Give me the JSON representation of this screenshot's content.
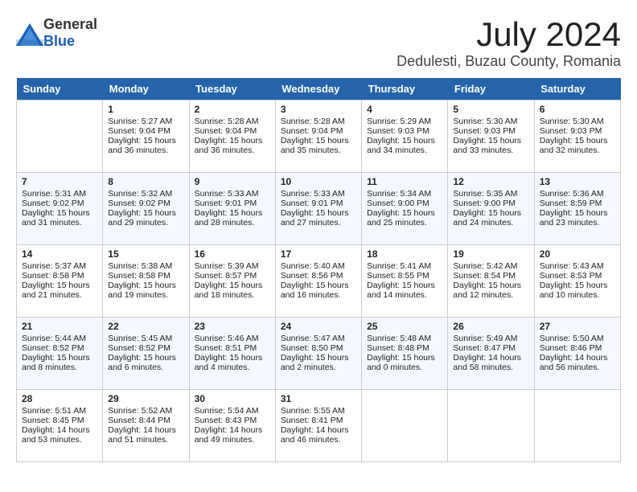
{
  "header": {
    "logo_general": "General",
    "logo_blue": "Blue",
    "month": "July 2024",
    "location": "Dedulesti, Buzau County, Romania"
  },
  "weekdays": [
    "Sunday",
    "Monday",
    "Tuesday",
    "Wednesday",
    "Thursday",
    "Friday",
    "Saturday"
  ],
  "weeks": [
    [
      {
        "day": "",
        "empty": true
      },
      {
        "day": "1",
        "sunrise": "Sunrise: 5:27 AM",
        "sunset": "Sunset: 9:04 PM",
        "daylight": "Daylight: 15 hours and 36 minutes."
      },
      {
        "day": "2",
        "sunrise": "Sunrise: 5:28 AM",
        "sunset": "Sunset: 9:04 PM",
        "daylight": "Daylight: 15 hours and 36 minutes."
      },
      {
        "day": "3",
        "sunrise": "Sunrise: 5:28 AM",
        "sunset": "Sunset: 9:04 PM",
        "daylight": "Daylight: 15 hours and 35 minutes."
      },
      {
        "day": "4",
        "sunrise": "Sunrise: 5:29 AM",
        "sunset": "Sunset: 9:03 PM",
        "daylight": "Daylight: 15 hours and 34 minutes."
      },
      {
        "day": "5",
        "sunrise": "Sunrise: 5:30 AM",
        "sunset": "Sunset: 9:03 PM",
        "daylight": "Daylight: 15 hours and 33 minutes."
      },
      {
        "day": "6",
        "sunrise": "Sunrise: 5:30 AM",
        "sunset": "Sunset: 9:03 PM",
        "daylight": "Daylight: 15 hours and 32 minutes."
      }
    ],
    [
      {
        "day": "7",
        "sunrise": "Sunrise: 5:31 AM",
        "sunset": "Sunset: 9:02 PM",
        "daylight": "Daylight: 15 hours and 31 minutes."
      },
      {
        "day": "8",
        "sunrise": "Sunrise: 5:32 AM",
        "sunset": "Sunset: 9:02 PM",
        "daylight": "Daylight: 15 hours and 29 minutes."
      },
      {
        "day": "9",
        "sunrise": "Sunrise: 5:33 AM",
        "sunset": "Sunset: 9:01 PM",
        "daylight": "Daylight: 15 hours and 28 minutes."
      },
      {
        "day": "10",
        "sunrise": "Sunrise: 5:33 AM",
        "sunset": "Sunset: 9:01 PM",
        "daylight": "Daylight: 15 hours and 27 minutes."
      },
      {
        "day": "11",
        "sunrise": "Sunrise: 5:34 AM",
        "sunset": "Sunset: 9:00 PM",
        "daylight": "Daylight: 15 hours and 25 minutes."
      },
      {
        "day": "12",
        "sunrise": "Sunrise: 5:35 AM",
        "sunset": "Sunset: 9:00 PM",
        "daylight": "Daylight: 15 hours and 24 minutes."
      },
      {
        "day": "13",
        "sunrise": "Sunrise: 5:36 AM",
        "sunset": "Sunset: 8:59 PM",
        "daylight": "Daylight: 15 hours and 23 minutes."
      }
    ],
    [
      {
        "day": "14",
        "sunrise": "Sunrise: 5:37 AM",
        "sunset": "Sunset: 8:58 PM",
        "daylight": "Daylight: 15 hours and 21 minutes."
      },
      {
        "day": "15",
        "sunrise": "Sunrise: 5:38 AM",
        "sunset": "Sunset: 8:58 PM",
        "daylight": "Daylight: 15 hours and 19 minutes."
      },
      {
        "day": "16",
        "sunrise": "Sunrise: 5:39 AM",
        "sunset": "Sunset: 8:57 PM",
        "daylight": "Daylight: 15 hours and 18 minutes."
      },
      {
        "day": "17",
        "sunrise": "Sunrise: 5:40 AM",
        "sunset": "Sunset: 8:56 PM",
        "daylight": "Daylight: 15 hours and 16 minutes."
      },
      {
        "day": "18",
        "sunrise": "Sunrise: 5:41 AM",
        "sunset": "Sunset: 8:55 PM",
        "daylight": "Daylight: 15 hours and 14 minutes."
      },
      {
        "day": "19",
        "sunrise": "Sunrise: 5:42 AM",
        "sunset": "Sunset: 8:54 PM",
        "daylight": "Daylight: 15 hours and 12 minutes."
      },
      {
        "day": "20",
        "sunrise": "Sunrise: 5:43 AM",
        "sunset": "Sunset: 8:53 PM",
        "daylight": "Daylight: 15 hours and 10 minutes."
      }
    ],
    [
      {
        "day": "21",
        "sunrise": "Sunrise: 5:44 AM",
        "sunset": "Sunset: 8:52 PM",
        "daylight": "Daylight: 15 hours and 8 minutes."
      },
      {
        "day": "22",
        "sunrise": "Sunrise: 5:45 AM",
        "sunset": "Sunset: 8:52 PM",
        "daylight": "Daylight: 15 hours and 6 minutes."
      },
      {
        "day": "23",
        "sunrise": "Sunrise: 5:46 AM",
        "sunset": "Sunset: 8:51 PM",
        "daylight": "Daylight: 15 hours and 4 minutes."
      },
      {
        "day": "24",
        "sunrise": "Sunrise: 5:47 AM",
        "sunset": "Sunset: 8:50 PM",
        "daylight": "Daylight: 15 hours and 2 minutes."
      },
      {
        "day": "25",
        "sunrise": "Sunrise: 5:48 AM",
        "sunset": "Sunset: 8:48 PM",
        "daylight": "Daylight: 15 hours and 0 minutes."
      },
      {
        "day": "26",
        "sunrise": "Sunrise: 5:49 AM",
        "sunset": "Sunset: 8:47 PM",
        "daylight": "Daylight: 14 hours and 58 minutes."
      },
      {
        "day": "27",
        "sunrise": "Sunrise: 5:50 AM",
        "sunset": "Sunset: 8:46 PM",
        "daylight": "Daylight: 14 hours and 56 minutes."
      }
    ],
    [
      {
        "day": "28",
        "sunrise": "Sunrise: 5:51 AM",
        "sunset": "Sunset: 8:45 PM",
        "daylight": "Daylight: 14 hours and 53 minutes."
      },
      {
        "day": "29",
        "sunrise": "Sunrise: 5:52 AM",
        "sunset": "Sunset: 8:44 PM",
        "daylight": "Daylight: 14 hours and 51 minutes."
      },
      {
        "day": "30",
        "sunrise": "Sunrise: 5:54 AM",
        "sunset": "Sunset: 8:43 PM",
        "daylight": "Daylight: 14 hours and 49 minutes."
      },
      {
        "day": "31",
        "sunrise": "Sunrise: 5:55 AM",
        "sunset": "Sunset: 8:41 PM",
        "daylight": "Daylight: 14 hours and 46 minutes."
      },
      {
        "day": "",
        "empty": true
      },
      {
        "day": "",
        "empty": true
      },
      {
        "day": "",
        "empty": true
      }
    ]
  ]
}
